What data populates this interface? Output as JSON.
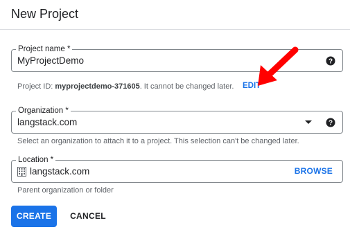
{
  "dialog": {
    "title": "New Project"
  },
  "project_name": {
    "label": "Project name *",
    "value": "MyProjectDemo",
    "hint_prefix": "Project ID: ",
    "project_id": "myprojectdemo-371605",
    "hint_suffix": ". It cannot be changed later.",
    "edit_label": "EDIT"
  },
  "organization": {
    "label": "Organization *",
    "value": "langstack.com",
    "hint": "Select an organization to attach it to a project. This selection can't be changed later."
  },
  "location": {
    "label": "Location *",
    "value": "langstack.com",
    "browse_label": "BROWSE",
    "hint": "Parent organization or folder"
  },
  "actions": {
    "create_label": "CREATE",
    "cancel_label": "CANCEL"
  },
  "icons": {
    "help": "help-circle-icon",
    "dropdown": "dropdown-arrow-icon",
    "location": "building-icon",
    "annotation": "red-arrow-icon"
  },
  "colors": {
    "accent": "#1a73e8",
    "annotation": "#ff0000",
    "border": "#80868b"
  }
}
